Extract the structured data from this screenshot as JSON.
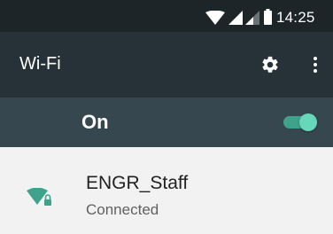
{
  "status_bar": {
    "time": "14:25",
    "icons": [
      "wifi-signal-icon",
      "cell-signal-icon",
      "cell-signal-weak-icon",
      "battery-icon"
    ]
  },
  "app_bar": {
    "title": "Wi-Fi",
    "actions": [
      "gear-icon",
      "overflow-menu-icon"
    ]
  },
  "master_switch": {
    "label": "On",
    "checked": true
  },
  "networks": [
    {
      "ssid": "ENGR_Staff",
      "status": "Connected",
      "icon": "wifi-locked-icon"
    }
  ],
  "colors": {
    "status_bar": "#1d2529",
    "app_bar": "#263238",
    "switch_bar": "#37474f",
    "accent": "#3fa28a",
    "accent_light": "#67d6b9",
    "list_background": "#f2f2f2"
  }
}
